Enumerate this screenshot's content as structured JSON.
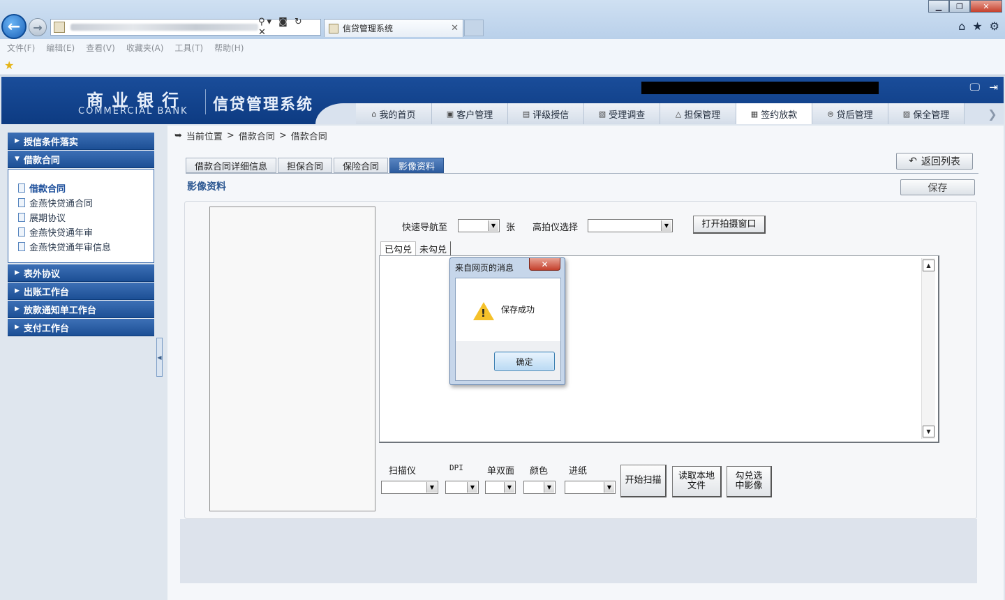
{
  "browser": {
    "tab_title": "信贷管理系统",
    "menu": [
      "文件(F)",
      "编辑(E)",
      "查看(V)",
      "收藏夹(A)",
      "工具(T)",
      "帮助(H)"
    ],
    "address_tools": "⚲▾ ◙ ↻ ✕"
  },
  "header": {
    "bank_name_cn": "商业银行",
    "bank_name_en": "COMMERCIAL BANK",
    "system_title": "信贷管理系统"
  },
  "top_nav": [
    {
      "label": "我的首页",
      "icon": "home-icon",
      "glyph": "⌂"
    },
    {
      "label": "客户管理",
      "icon": "customer-icon",
      "glyph": "▣"
    },
    {
      "label": "评级授信",
      "icon": "rating-icon",
      "glyph": "▤"
    },
    {
      "label": "受理调查",
      "icon": "survey-icon",
      "glyph": "▧"
    },
    {
      "label": "担保管理",
      "icon": "guarantee-icon",
      "glyph": "△"
    },
    {
      "label": "签约放款",
      "icon": "sign-icon",
      "glyph": "▦",
      "active": true
    },
    {
      "label": "贷后管理",
      "icon": "post-loan-icon",
      "glyph": "⊜"
    },
    {
      "label": "保全管理",
      "icon": "preservation-icon",
      "glyph": "▨"
    }
  ],
  "sidebar": {
    "sections": [
      {
        "label": "授信条件落实"
      },
      {
        "label": "借款合同"
      }
    ],
    "links": [
      {
        "label": "借款合同",
        "active": true
      },
      {
        "label": "金燕快贷通合同"
      },
      {
        "label": "展期协议"
      },
      {
        "label": "金燕快贷通年审"
      },
      {
        "label": "金燕快贷通年审信息"
      }
    ],
    "sections_after": [
      {
        "label": "表外协议"
      },
      {
        "label": "出账工作台"
      },
      {
        "label": "放款通知单工作台"
      },
      {
        "label": "支付工作台"
      }
    ]
  },
  "breadcrumb": {
    "prefix": "当前位置",
    "sep": ">",
    "items": [
      "借款合同",
      "借款合同"
    ]
  },
  "tabs": [
    {
      "label": "借款合同详细信息"
    },
    {
      "label": "担保合同"
    },
    {
      "label": "保险合同"
    },
    {
      "label": "影像资料",
      "active": true
    }
  ],
  "section_title": "影像资料",
  "buttons": {
    "back_to_list": "返回列表",
    "save": "保存",
    "open_camera": "打开拍摄窗口",
    "start_scan": "开始扫描",
    "read_local": "读取本地文件",
    "check_selected": "勾兑选中影像"
  },
  "nav_controls": {
    "quick_nav_label": "快速导航至",
    "quick_nav_unit": "张",
    "camera_select_label": "高拍仪选择"
  },
  "sub_tabs": [
    "已勾兑",
    "未勾兑"
  ],
  "scan_controls": {
    "scanner_label": "扫描仪",
    "dpi_label": "DPI",
    "duplex_label": "单双面",
    "color_label": "颜色",
    "feed_label": "进纸"
  },
  "dialog": {
    "title": "来自网页的消息",
    "message": "保存成功",
    "ok": "确定"
  }
}
